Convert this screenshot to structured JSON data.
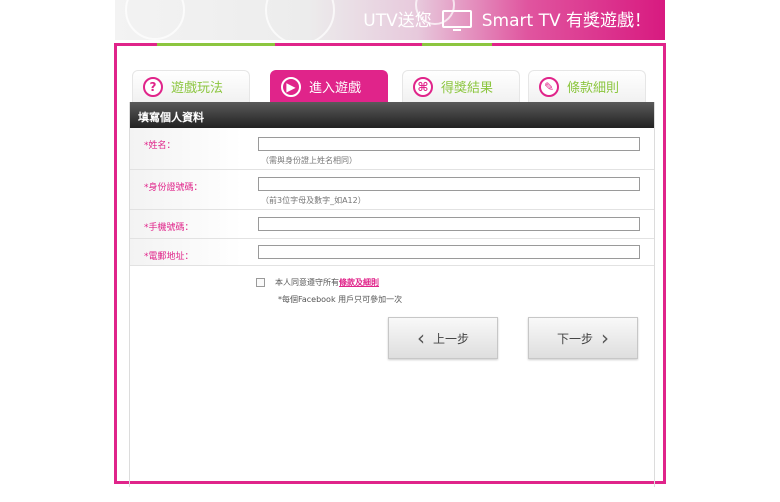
{
  "banner": {
    "prefix": "UTV送您",
    "product": "Smart TV 有獎遊戲！"
  },
  "tabs": [
    {
      "label": "遊戲玩法",
      "icon": "?"
    },
    {
      "label": "進入遊戲",
      "icon": "▶"
    },
    {
      "label": "得獎結果",
      "icon": "⌘"
    },
    {
      "label": "條款細則",
      "icon": "✎"
    }
  ],
  "form": {
    "title": "填寫個人資料",
    "fields": [
      {
        "label": "*姓名：",
        "value": "",
        "hint": "（需與身份證上姓名相同）"
      },
      {
        "label": "*身份證號碼：",
        "value": "",
        "hint": "（前3位字母及數字_如A12）"
      },
      {
        "label": "*手機號碼：",
        "value": ""
      },
      {
        "label": "*電郵地址：",
        "value": ""
      }
    ],
    "agree_text": "本人同意遵守所有",
    "terms_link": "條款及細則",
    "note": "*每個Facebook 用戶只可參加一次",
    "prev_label": "上一步",
    "next_label": "下一步"
  },
  "colors": {
    "accent": "#e0248a",
    "tab_text": "#8cc63f"
  }
}
